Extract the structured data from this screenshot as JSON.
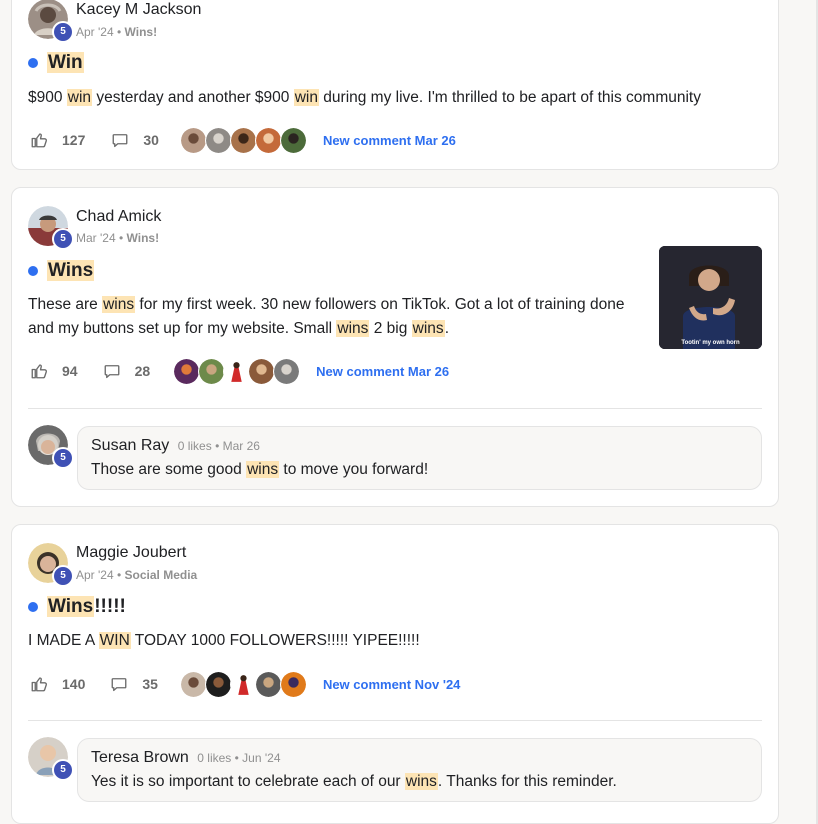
{
  "posts": [
    {
      "author": "Kacey M Jackson",
      "level": "5",
      "date": "Apr '24",
      "category": "Wins!",
      "title": [
        "Win"
      ],
      "body": [
        "$900 ",
        "win",
        " yesterday and another $900 ",
        "win",
        " during my live. I'm thrilled to be apart of this community"
      ],
      "likes": "127",
      "comments": "30",
      "new_comment": "New comment Mar 26"
    },
    {
      "author": "Chad Amick",
      "level": "5",
      "date": "Mar '24",
      "category": "Wins!",
      "title": [
        "Wins"
      ],
      "body_line1": [
        "These are ",
        "wins",
        " for my first week. 30 new followers on TikTok. Got a lot of training done"
      ],
      "body_line2": [
        "and my buttons set up for my website. Small ",
        "wins",
        " 2 big ",
        "wins",
        "."
      ],
      "image_caption": "Tootin' my own horn",
      "likes": "94",
      "comments": "28",
      "new_comment": "New comment Mar 26",
      "reply": {
        "author": "Susan Ray",
        "level": "5",
        "likes": "0 likes",
        "date": "Mar 26",
        "text": [
          "Those are some good ",
          "wins",
          " to move you forward!"
        ]
      }
    },
    {
      "author": "Maggie Joubert",
      "level": "5",
      "date": "Apr '24",
      "category": "Social Media",
      "title": [
        "Wins",
        "!!!!!"
      ],
      "body": [
        "I MADE A ",
        "WIN",
        " TODAY 1000 FOLLOWERS!!!!! YIPEE!!!!!"
      ],
      "likes": "140",
      "comments": "35",
      "new_comment": "New comment Nov '24",
      "reply": {
        "author": "Teresa Brown",
        "level": "5",
        "likes": "0 likes",
        "date": "Jun '24",
        "text": [
          "Yes it is so important to celebrate each of our ",
          "wins",
          ". Thanks for this reminder."
        ]
      }
    }
  ],
  "colors": {
    "accent": "#2e6ff0",
    "badge": "#3f51b5",
    "highlight": "#fde4b4"
  },
  "icons": {
    "like": "thumbs-up-icon",
    "comment": "comment-icon"
  }
}
